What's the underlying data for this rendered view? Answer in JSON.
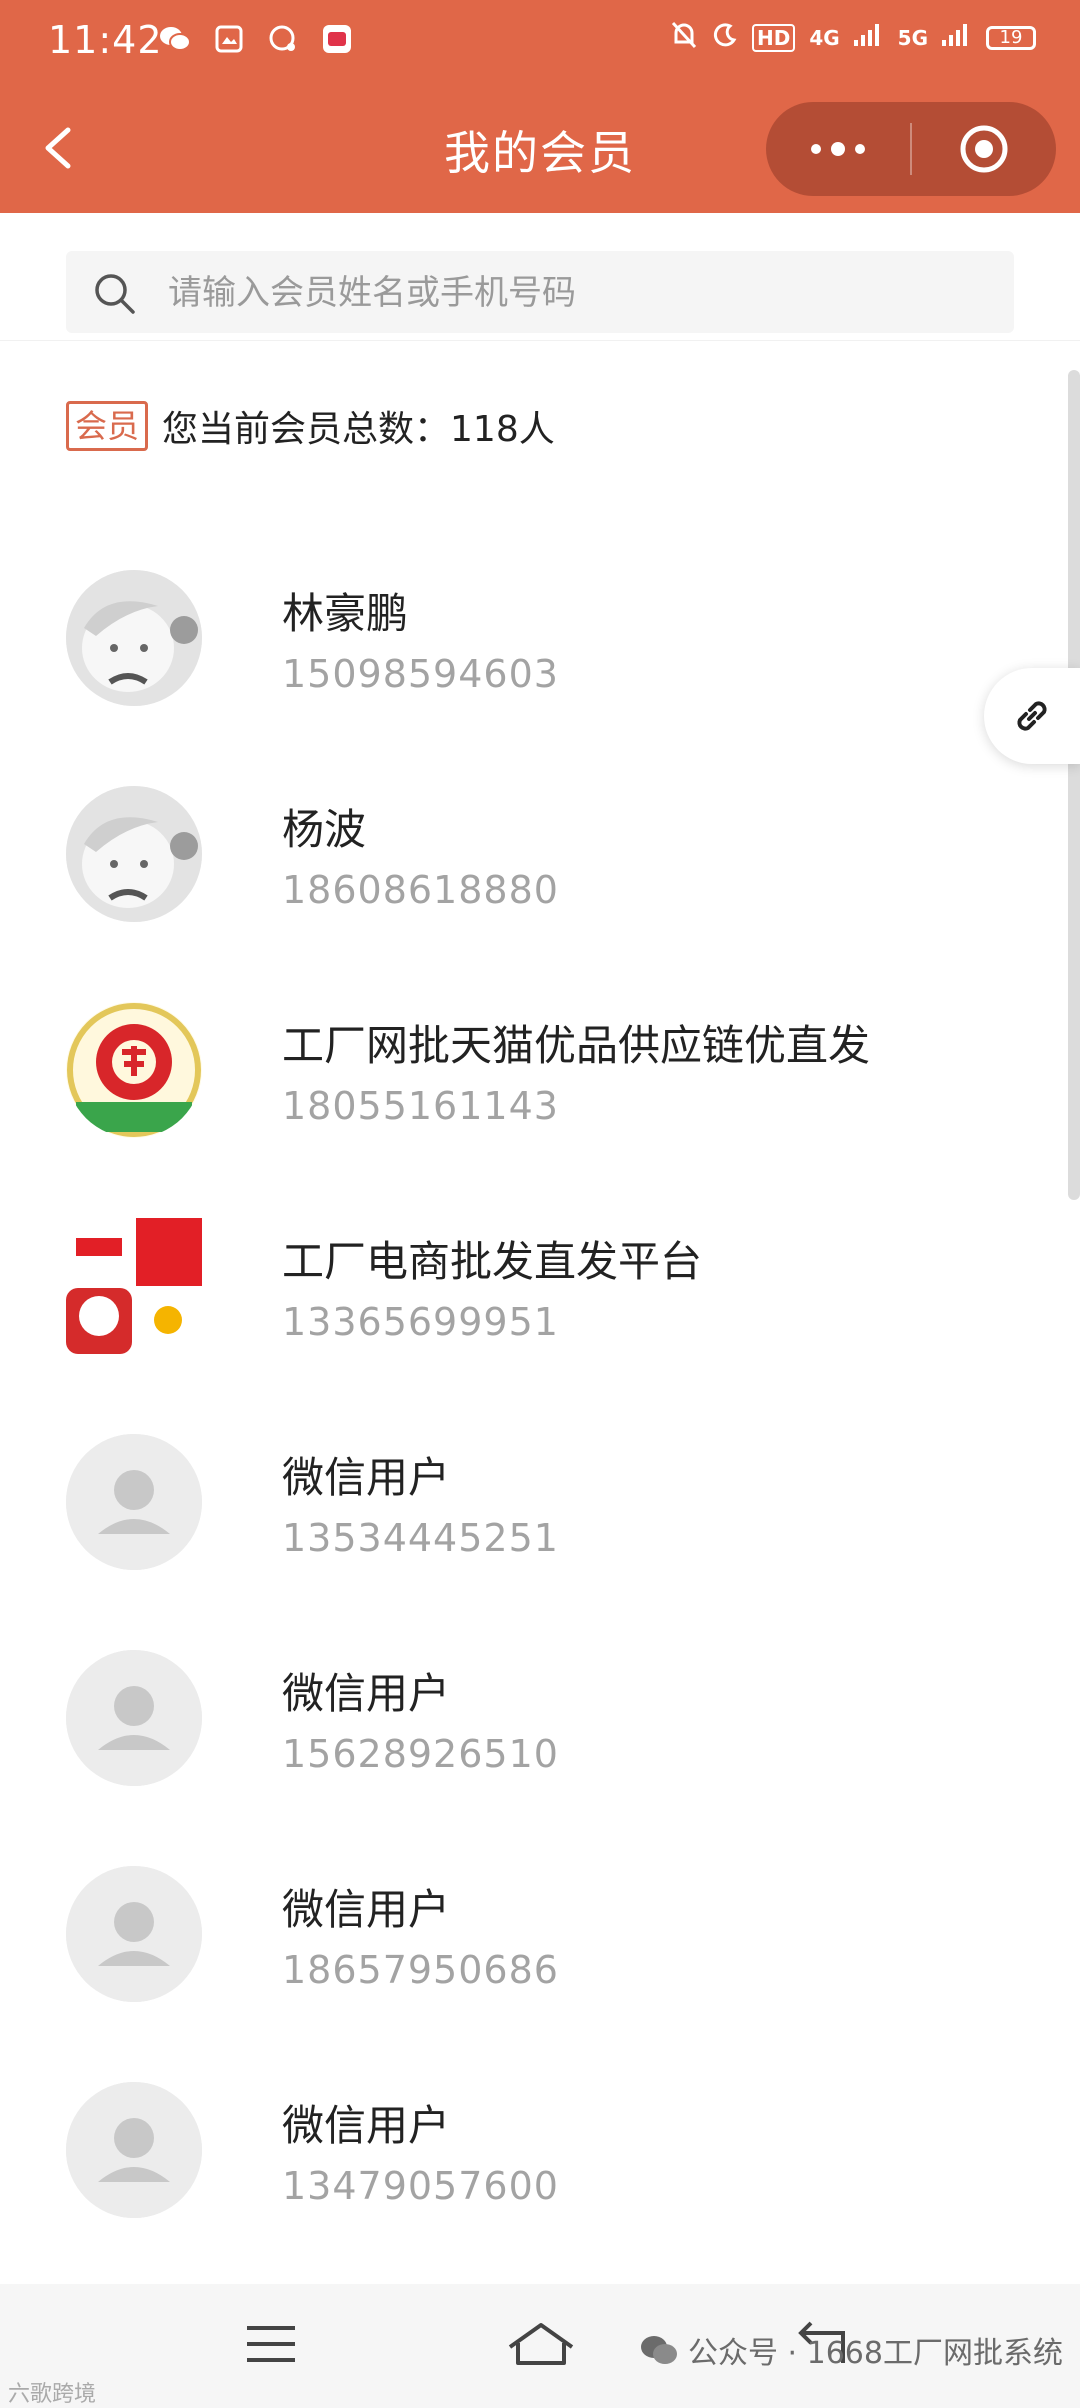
{
  "status_bar": {
    "time": "11:42",
    "network_labels": [
      "HD",
      "4G",
      "5G"
    ],
    "battery": "19"
  },
  "header": {
    "title": "我的会员"
  },
  "search": {
    "placeholder": "请输入会员姓名或手机号码"
  },
  "summary": {
    "tag": "会员",
    "text": "您当前会员总数：118人"
  },
  "members": [
    {
      "name": "林豪鹏",
      "phone": "15098594603",
      "avatar": "cartoon-avatar"
    },
    {
      "name": "杨波",
      "phone": "18608618880",
      "avatar": "cartoon-avatar"
    },
    {
      "name": "工厂网批天猫优品供应链优直发",
      "phone": "18055161143",
      "avatar": "fu-logo-avatar"
    },
    {
      "name": "工厂电商批发直发平台",
      "phone": "13365699951",
      "avatar": "ecommerce-logos-avatar"
    },
    {
      "name": "微信用户",
      "phone": "13534445251",
      "avatar": "default-avatar"
    },
    {
      "name": "微信用户",
      "phone": "15628926510",
      "avatar": "default-avatar"
    },
    {
      "name": "微信用户",
      "phone": "18657950686",
      "avatar": "default-avatar"
    },
    {
      "name": "微信用户",
      "phone": "13479057600",
      "avatar": "default-avatar"
    }
  ],
  "watermark": {
    "text": "公众号 · 1668工厂网批系统"
  },
  "corner_mark": "六歌跨境",
  "colors": {
    "header_bg": "#e06748",
    "accent": "#d96a4d"
  }
}
